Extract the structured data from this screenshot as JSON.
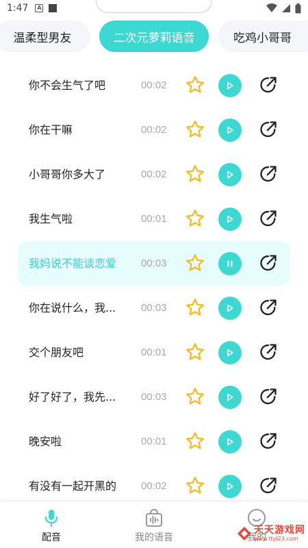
{
  "status_bar": {
    "time": "1:47",
    "a_icon_letter": "A"
  },
  "tabs": [
    {
      "label": "温柔型男友",
      "active": false
    },
    {
      "label": "二次元萝莉语音",
      "active": true
    },
    {
      "label": "吃鸡小哥哥",
      "active": false
    }
  ],
  "voices": [
    {
      "title": "你不会生气了吧",
      "duration": "00:02",
      "playing": false
    },
    {
      "title": "你在干嘛",
      "duration": "00:02",
      "playing": false
    },
    {
      "title": "小哥哥你多大了",
      "duration": "00:02",
      "playing": false
    },
    {
      "title": "我生气啦",
      "duration": "00:01",
      "playing": false
    },
    {
      "title": "我妈说不能谈恋爱",
      "duration": "00:03",
      "playing": true
    },
    {
      "title": "你在说什么，我...",
      "duration": "00:03",
      "playing": false
    },
    {
      "title": "交个朋友吧",
      "duration": "00:01",
      "playing": false
    },
    {
      "title": "好了好了，我先...",
      "duration": "00:03",
      "playing": false
    },
    {
      "title": "晚安啦",
      "duration": "00:01",
      "playing": false
    },
    {
      "title": "有没有一起开黑的",
      "duration": "00:02",
      "playing": false
    }
  ],
  "bottom_nav": {
    "dub_label": "配音",
    "my_voice_label": "我的语音",
    "me_label": "我的"
  },
  "watermark": {
    "title": "天天游戏网",
    "url": "www.ttyl23.com"
  },
  "colors": {
    "accent": "#3dd8d2",
    "star": "#f7b91c",
    "playing_bg": "#e7fcfc"
  }
}
